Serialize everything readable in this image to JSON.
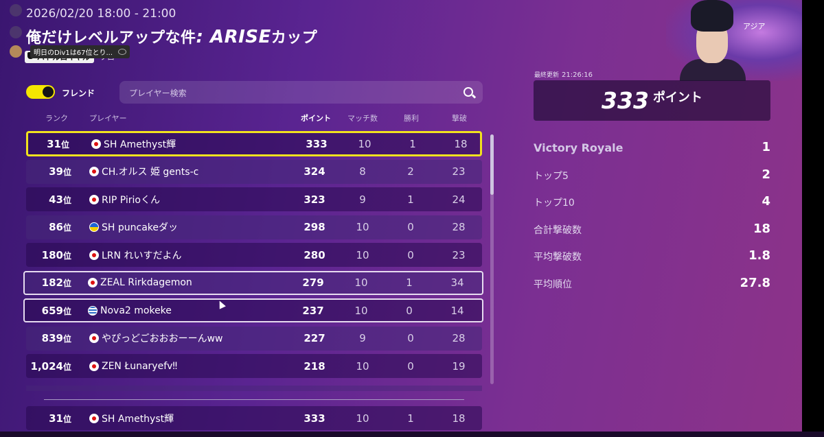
{
  "header": {
    "datetime": "2026/02/20 18:00 - 21:00",
    "title_prefix": "俺だけレベルアップな件",
    "title_em": ": ARISE",
    "title_suffix": "カップ",
    "mode": "バトルロイヤル",
    "submode": "ソロ",
    "tooltip": "明日のDiv1は67位とり..."
  },
  "toolbar": {
    "friend_label": "フレンド",
    "friend_toggle_on": true,
    "search_placeholder": "プレイヤー検索"
  },
  "columns": {
    "rank": "ランク",
    "player": "プレイヤー",
    "points": "ポイント",
    "matches": "マッチ数",
    "wins": "勝利",
    "elims": "撃破"
  },
  "rank_suffix": "位",
  "rows": [
    {
      "rank": "31",
      "flag": "jp",
      "name": "SH Amethyst輝",
      "points": "333",
      "matches": "10",
      "wins": "1",
      "elims": "18"
    },
    {
      "rank": "39",
      "flag": "jp",
      "name": "CH.オルス 姫 gents-c",
      "points": "324",
      "matches": "8",
      "wins": "2",
      "elims": "23"
    },
    {
      "rank": "43",
      "flag": "jp",
      "name": "RIP Pirioくん",
      "points": "323",
      "matches": "9",
      "wins": "1",
      "elims": "24"
    },
    {
      "rank": "86",
      "flag": "ua",
      "name": "SH puncakeダッ",
      "points": "298",
      "matches": "10",
      "wins": "0",
      "elims": "28"
    },
    {
      "rank": "180",
      "flag": "jp",
      "name": "LRN れいすだよん",
      "points": "280",
      "matches": "10",
      "wins": "0",
      "elims": "23"
    },
    {
      "rank": "182",
      "flag": "jp",
      "name": "ZEAL Rirkdagemon",
      "points": "279",
      "matches": "10",
      "wins": "1",
      "elims": "34"
    },
    {
      "rank": "659",
      "flag": "gr",
      "name": "Nova2 mokeke",
      "points": "237",
      "matches": "10",
      "wins": "0",
      "elims": "14"
    },
    {
      "rank": "839",
      "flag": "jp",
      "name": "やぴっどごおおおーーんww",
      "points": "227",
      "matches": "9",
      "wins": "0",
      "elims": "28"
    },
    {
      "rank": "1,024",
      "flag": "jp",
      "name": "ZEN Łunaryefv‼",
      "points": "218",
      "matches": "10",
      "wins": "0",
      "elims": "19"
    }
  ],
  "pinned": {
    "rank": "31",
    "flag": "jp",
    "name": "SH Amethyst輝",
    "points": "333",
    "matches": "10",
    "wins": "1",
    "elims": "18"
  },
  "panel": {
    "region": "アジア",
    "last_updated_label": "最終更新",
    "last_updated": "21:26:16",
    "points": "333",
    "points_unit": "ポイント",
    "stats": [
      {
        "label": "Victory Royale",
        "value": "1"
      },
      {
        "label": "トップ5",
        "value": "2"
      },
      {
        "label": "トップ10",
        "value": "4"
      },
      {
        "label": "合計撃破数",
        "value": "18"
      },
      {
        "label": "平均撃破数",
        "value": "1.8"
      },
      {
        "label": "平均順位",
        "value": "27.8"
      }
    ]
  },
  "colors": {
    "accent_yellow": "#f1e21e",
    "bg_purple": "#5a2491"
  }
}
